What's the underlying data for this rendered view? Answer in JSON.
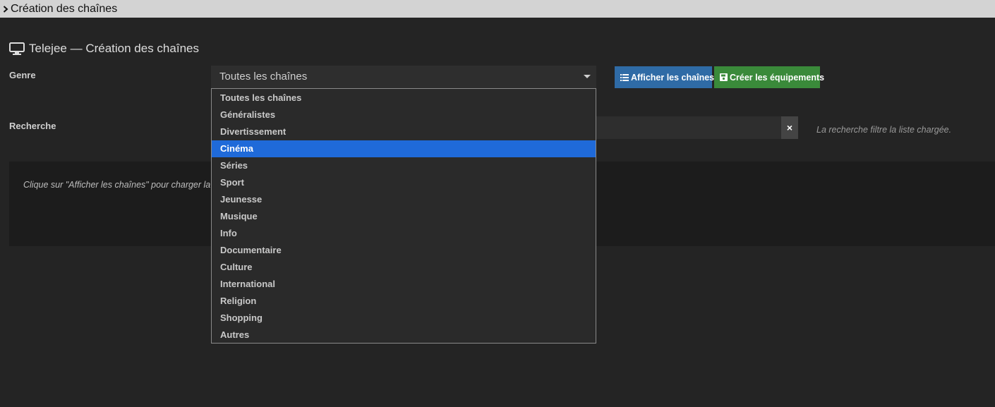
{
  "window": {
    "title": "Création des chaînes"
  },
  "page": {
    "heading": "Telejee — Création des chaînes"
  },
  "form": {
    "genre_label": "Genre",
    "genre_value": "Toutes les chaînes",
    "genre_options": [
      "Toutes les chaînes",
      "Généralistes",
      "Divertissement",
      "Cinéma",
      "Séries",
      "Sport",
      "Jeunesse",
      "Musique",
      "Info",
      "Documentaire",
      "Culture",
      "International",
      "Religion",
      "Shopping",
      "Autres"
    ],
    "highlighted_option": "Cinéma",
    "search_label": "Recherche",
    "search_value": "",
    "search_clear": "×",
    "search_hint": "La recherche filtre la liste chargée."
  },
  "toolbar": {
    "show_label": "Afficher les chaînes",
    "create_label": "Créer les équipements"
  },
  "result": {
    "message": "Clique sur \"Afficher les chaînes\" pour charger la"
  },
  "icons": {
    "chevron": "chevron-right-icon",
    "tv": "tv-icon",
    "list": "list-icon",
    "save": "save-icon",
    "clear": "close-icon"
  },
  "colors": {
    "background": "#242424",
    "topbar": "#d3d3d3",
    "primary": "#2f6ba6",
    "success": "#3a8a3a",
    "highlight": "#1f6ad9"
  }
}
